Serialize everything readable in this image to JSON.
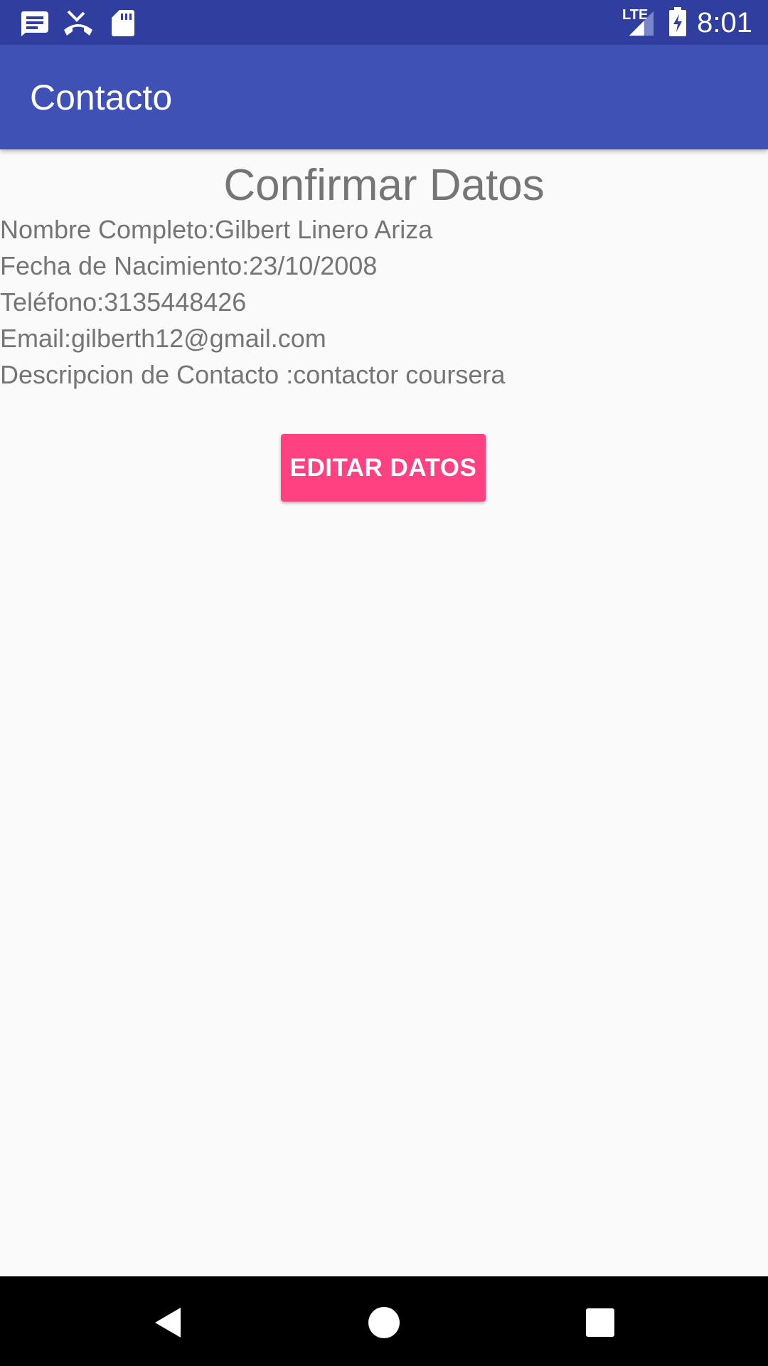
{
  "status_bar": {
    "time": "8:01",
    "network_label": "LTE",
    "icons": [
      "message-icon",
      "missed-call-icon",
      "sd-card-icon",
      "signal-icon",
      "battery-charging-icon"
    ]
  },
  "app_bar": {
    "title": "Contacto"
  },
  "main": {
    "heading": "Confirmar Datos",
    "fields": {
      "nombre": "Nombre Completo:Gilbert Linero Ariza",
      "fecha": "Fecha de Nacimiento:23/10/2008",
      "telefono": "Teléfono:3135448426",
      "email": "Email:gilberth12@gmail.com",
      "descripcion": "Descripcion de Contacto :contactor coursera"
    },
    "edit_button_label": "EDITAR DATOS"
  },
  "nav_bar": {
    "icons": [
      "back-icon",
      "home-icon",
      "recents-icon"
    ]
  },
  "colors": {
    "status_bar": "#303f9f",
    "app_bar": "#3f51b5",
    "accent": "#ff4081",
    "text": "#757575",
    "background": "#fafafa"
  }
}
